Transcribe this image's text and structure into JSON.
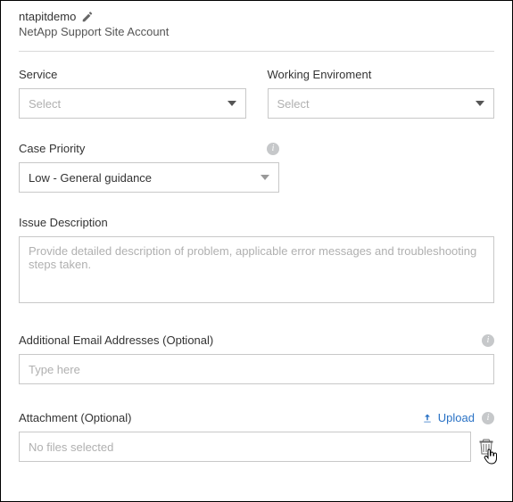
{
  "header": {
    "account_name": "ntapitdemo",
    "subtitle": "NetApp Support Site Account"
  },
  "fields": {
    "service": {
      "label": "Service",
      "placeholder": "Select"
    },
    "working_env": {
      "label": "Working Enviroment",
      "placeholder": "Select"
    },
    "case_priority": {
      "label": "Case Priority",
      "value": "Low - General guidance"
    },
    "issue_description": {
      "label": "Issue Description",
      "placeholder": "Provide detailed description of problem, applicable error messages and troubleshooting steps taken."
    },
    "additional_emails": {
      "label": "Additional Email Addresses (Optional)",
      "placeholder": "Type here"
    },
    "attachment": {
      "label": "Attachment (Optional)",
      "upload_label": "Upload",
      "no_files": "No files selected"
    }
  },
  "icons": {
    "pencil": "pencil-icon",
    "info": "info-icon",
    "upload": "upload-icon",
    "trash": "trash-icon"
  }
}
